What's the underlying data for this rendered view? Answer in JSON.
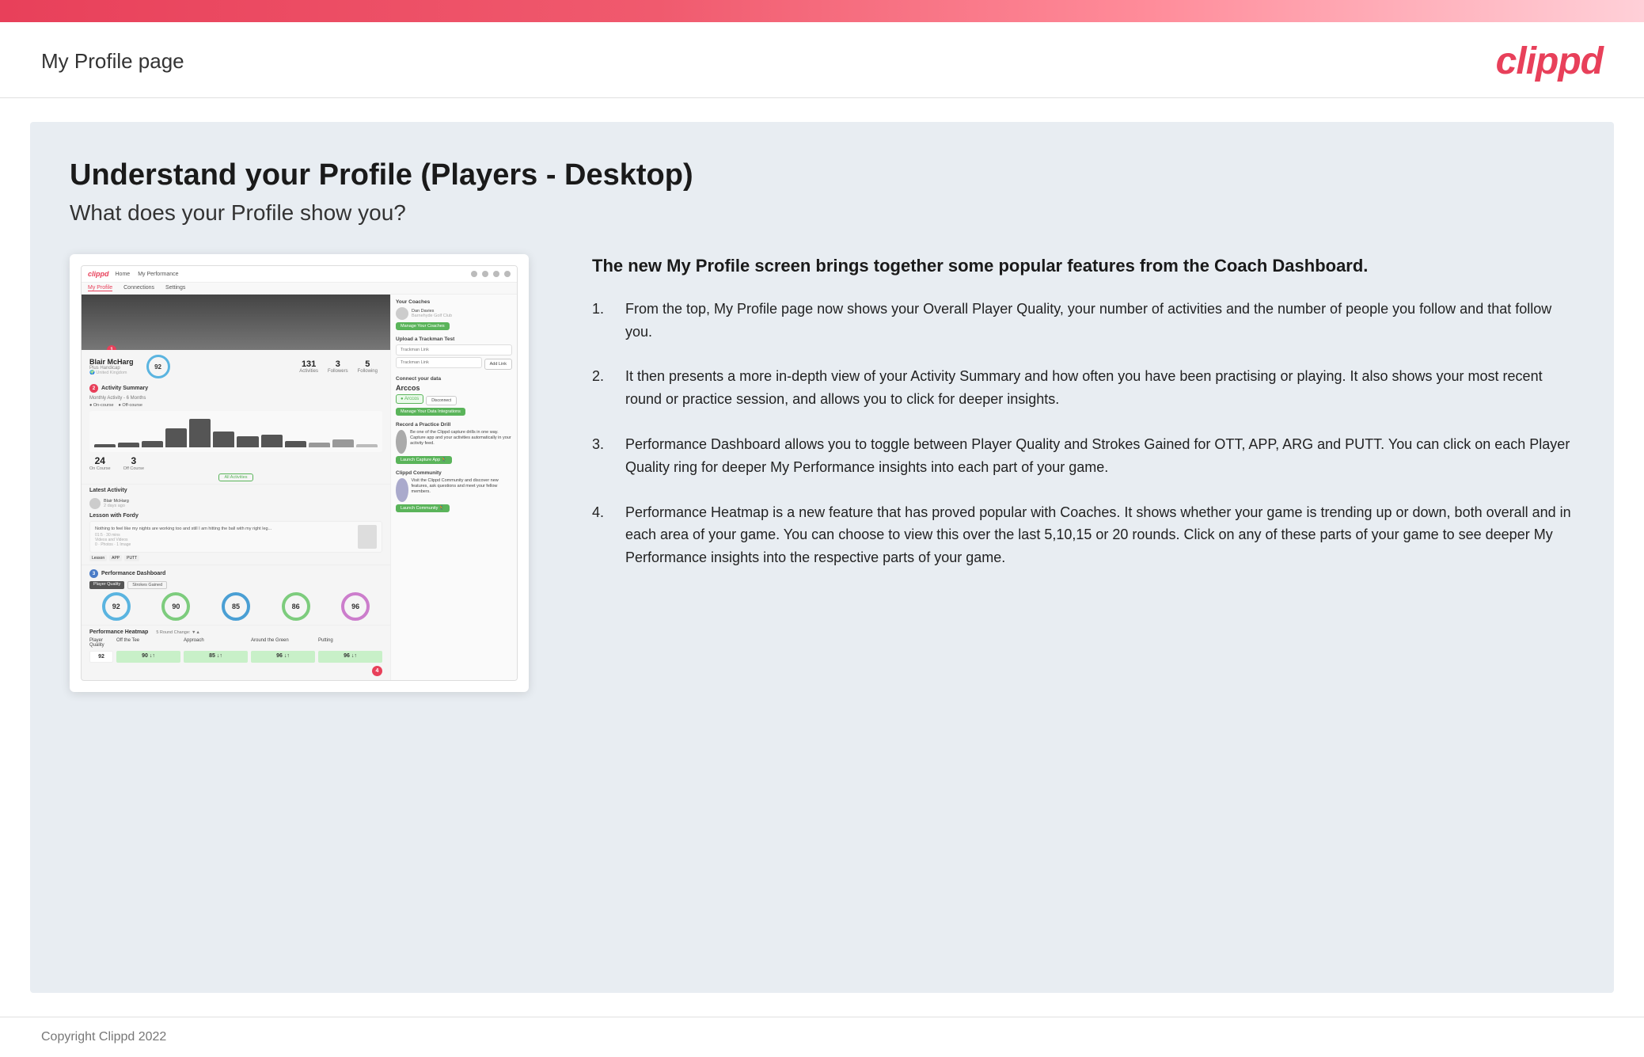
{
  "header": {
    "title": "My Profile page",
    "logo": "clippd"
  },
  "main": {
    "title": "Understand your Profile (Players - Desktop)",
    "subtitle": "What does your Profile show you?",
    "info_lead": "The new My Profile screen brings together some popular features from the Coach Dashboard.",
    "list_items": [
      "From the top, My Profile page now shows your Overall Player Quality, your number of activities and the number of people you follow and that follow you.",
      "It then presents a more in-depth view of your Activity Summary and how often you have been practising or playing. It also shows your most recent round or practice session, and allows you to click for deeper insights.",
      "Performance Dashboard allows you to toggle between Player Quality and Strokes Gained for OTT, APP, ARG and PUTT. You can click on each Player Quality ring for deeper My Performance insights into each part of your game.",
      "Performance Heatmap is a new feature that has proved popular with Coaches. It shows whether your game is trending up or down, both overall and in each area of your game. You can choose to view this over the last 5,10,15 or 20 rounds. Click on any of these parts of your game to see deeper My Performance insights into the respective parts of your game."
    ]
  },
  "mockup": {
    "nav": {
      "logo": "clippd",
      "items": [
        "Home",
        "My Performance"
      ]
    },
    "sub_nav": {
      "items": [
        "My Profile",
        "Connections",
        "Settings"
      ],
      "active": "My Profile"
    },
    "profile": {
      "name": "Blair McHarg",
      "handicap": "Plus Handicap",
      "quality": "92",
      "activities": "131",
      "followers": "3",
      "following": "5"
    },
    "activity": {
      "on_course": "24",
      "off_course": "3"
    },
    "performance": {
      "rings": [
        "92",
        "90",
        "85",
        "86",
        "96"
      ]
    },
    "heatmap": {
      "cells": [
        "92",
        "90 ↓↑",
        "85 ↓↑",
        "96 ↓↑",
        "96 ↓↑"
      ]
    },
    "coaches": {
      "title": "Your Coaches",
      "name": "Dan Davies",
      "club": "Barnehyde Golf Club",
      "btn": "Manage Your Coaches"
    },
    "trackman": {
      "title": "Upload a Trackman Test",
      "placeholder": "Trackman Link",
      "btn": "Add Link"
    },
    "connect": {
      "title": "Connect your data",
      "brand": "Arccos",
      "btn": "Manage Your Data Integrations"
    },
    "drill": {
      "title": "Record a Practice Drill",
      "btn": "Launch Capture App"
    },
    "community": {
      "title": "Clippd Community",
      "text": "Visit the Clippd Community and discover new features, ask questions and meet your fellow members.",
      "btn": "Launch Community"
    }
  },
  "footer": {
    "text": "Copyright Clippd 2022"
  }
}
